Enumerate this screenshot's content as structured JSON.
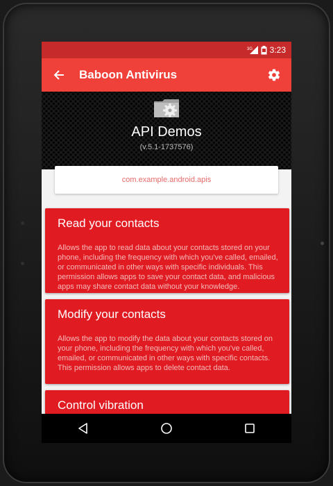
{
  "status": {
    "network": "3G",
    "time": "3:23"
  },
  "toolbar": {
    "title": "Baboon Antivirus"
  },
  "app": {
    "name": "API Demos",
    "version": "(v.5.1-1737576)",
    "package": "com.example.android.apis"
  },
  "permissions": [
    {
      "title": "Read your contacts",
      "description": "Allows the app to read data about your contacts stored on your phone, including the frequency with which you've called, emailed, or communicated in other ways with specific individuals. This permission allows apps to save your contact data, and malicious apps may share contact data without your knowledge."
    },
    {
      "title": "Modify your contacts",
      "description": "Allows the app to modify the data about your contacts stored on your phone, including the frequency with which you've called, emailed, or communicated in other ways with specific contacts. This permission allows apps to delete contact data."
    },
    {
      "title": "Control vibration",
      "description": ""
    }
  ],
  "colors": {
    "status_bar": "#c62a2a",
    "toolbar": "#f0403a",
    "card": "#e01b22",
    "package_text": "#e86a6a"
  },
  "icons": {
    "back": "arrow-back-icon",
    "settings": "gear-icon",
    "app": "settings-app-icon",
    "nav_back": "triangle-back-icon",
    "nav_home": "circle-home-icon",
    "nav_recents": "square-recents-icon"
  }
}
